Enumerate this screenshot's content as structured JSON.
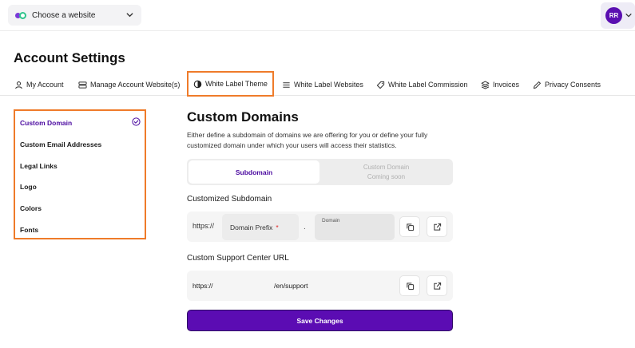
{
  "topbar": {
    "site_selector": "Choose a website",
    "user_initials": "RR"
  },
  "page": {
    "title": "Account Settings"
  },
  "tabs": [
    {
      "label": "My Account",
      "icon": "user-icon"
    },
    {
      "label": "Manage Account Website(s)",
      "icon": "stack-icon"
    },
    {
      "label": "White Label Theme",
      "icon": "contrast-icon",
      "active": true
    },
    {
      "label": "White Label Websites",
      "icon": "list-icon"
    },
    {
      "label": "White Label Commission",
      "icon": "tag-icon"
    },
    {
      "label": "Invoices",
      "icon": "layers-icon"
    },
    {
      "label": "Privacy Consents",
      "icon": "pen-icon"
    }
  ],
  "sidebar": {
    "items": [
      {
        "label": "Custom Domain",
        "active": true
      },
      {
        "label": "Custom Email Addresses"
      },
      {
        "label": "Legal Links"
      },
      {
        "label": "Logo"
      },
      {
        "label": "Colors"
      },
      {
        "label": "Fonts"
      }
    ]
  },
  "main": {
    "title": "Custom Domains",
    "description": "Either define a subdomain of domains we are offering for you or define your fully customized domain under which your users will access their statistics.",
    "segment": {
      "option1": "Subdomain",
      "option2": "Custom Domain",
      "option2_note": "Coming soon"
    },
    "subdomain": {
      "label": "Customized Subdomain",
      "prefix": "https://",
      "input_placeholder": "Domain Prefix",
      "required_mark": "*",
      "separator": ".",
      "domain_label": "Domain"
    },
    "support": {
      "label": "Custom Support Center URL",
      "prefix": "https://",
      "suffix": "/en/support"
    },
    "save_label": "Save Changes"
  },
  "colors": {
    "accent": "#5b0cb3",
    "highlight_border": "#ef7b2a"
  }
}
